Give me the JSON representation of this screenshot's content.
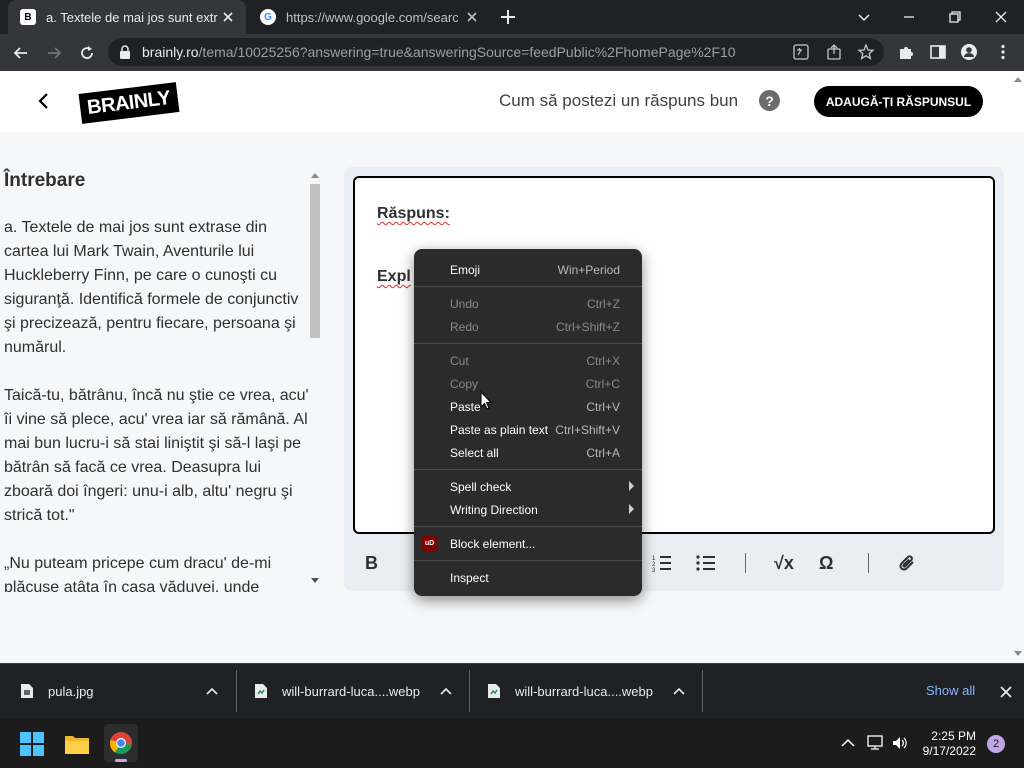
{
  "browser": {
    "tabs": [
      {
        "title": "a. Textele de mai jos sunt extrase",
        "favicon": "B",
        "active": true
      },
      {
        "title": "https://www.google.com/search?",
        "favicon": "G",
        "active": false
      }
    ],
    "url_host": "brainly.ro",
    "url_path": "/tema/10025256?answering=true&answeringSource=feedPublic%2FhomePage%2F10"
  },
  "header": {
    "logo": "BRAINLY",
    "how_to_answer": "Cum să postezi un răspuns bun",
    "help": "?",
    "add_answer_button": "ADAUGĂ-ȚI RĂSPUNSUL"
  },
  "question": {
    "title": "Întrebare",
    "paragraphs": [
      "a. Textele de mai jos sunt extrase din cartea lui Mark Twain, Aventurile lui Huckleberry Finn, pe care o cunoşti cu siguranţă. Identifică formele de conjunctiv şi precizează, pentru fiecare, persoana şi numărul.",
      "Taică-tu, bătrânu, încă nu ştie ce vrea, acu' îi vine să plece, acu' vrea iar să rămână. Al mai bun lucru-i să stai liniştit şi să-l laşi pe bătrân să facă ce vrea. Deasupra lui zboară doi îngeri: unu-i alb, altu' negru şi strică tot.\"",
      "„Nu puteam pricepe cum dracu' de-mi plăcuse atâta în casa văduvei, unde"
    ]
  },
  "editor": {
    "answer_label": "Răspuns:",
    "explanation_label": "Expl",
    "toolbar": {
      "bold": "B",
      "math": "√x",
      "omega": "Ω"
    }
  },
  "context_menu": {
    "items": [
      {
        "label": "Emoji",
        "shortcut": "Win+Period",
        "disabled": false
      },
      {
        "label": "Undo",
        "shortcut": "Ctrl+Z",
        "disabled": true
      },
      {
        "label": "Redo",
        "shortcut": "Ctrl+Shift+Z",
        "disabled": true
      },
      {
        "label": "Cut",
        "shortcut": "Ctrl+X",
        "disabled": true
      },
      {
        "label": "Copy",
        "shortcut": "Ctrl+C",
        "disabled": true
      },
      {
        "label": "Paste",
        "shortcut": "Ctrl+V",
        "disabled": false
      },
      {
        "label": "Paste as plain text",
        "shortcut": "Ctrl+Shift+V",
        "disabled": false
      },
      {
        "label": "Select all",
        "shortcut": "Ctrl+A",
        "disabled": false
      },
      {
        "label": "Spell check",
        "shortcut": "",
        "disabled": false,
        "submenu": true
      },
      {
        "label": "Writing Direction",
        "shortcut": "",
        "disabled": false,
        "submenu": true
      },
      {
        "label": "Block element...",
        "shortcut": "",
        "disabled": false,
        "icon": "ublock-origin-icon"
      },
      {
        "label": "Inspect",
        "shortcut": "",
        "disabled": false
      }
    ],
    "ublock_badge": "uD"
  },
  "downloads": {
    "items": [
      {
        "name": "pula.jpg"
      },
      {
        "name": "will-burrard-luca....webp"
      },
      {
        "name": "will-burrard-luca....webp"
      }
    ],
    "show_all": "Show all"
  },
  "taskbar": {
    "time": "2:25 PM",
    "date": "9/17/2022",
    "notifications": "2"
  },
  "colors": {
    "chrome_dark": "#202124",
    "chrome_toolbar": "#35363a",
    "menu_bg": "#2b2b2b",
    "brand_black": "#000000",
    "link_blue": "#8ab4f8"
  }
}
